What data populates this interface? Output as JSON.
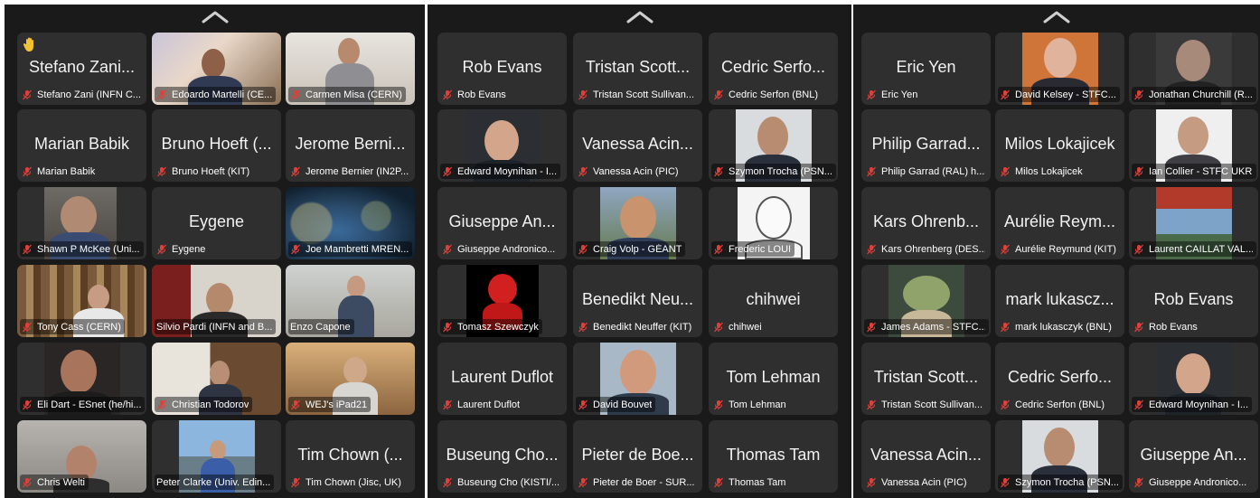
{
  "panels": [
    {
      "tiles": [
        {
          "big": "Stefano Zani...",
          "label": "Stefano Zani (INFN C...",
          "muted": true,
          "hand_raised": true
        },
        {
          "big": "",
          "label": "Edoardo Martelli (CE...",
          "muted": true,
          "video": "room-poster"
        },
        {
          "big": "",
          "label": "Carmen Misa (CERN)",
          "muted": true,
          "video": "person-light"
        },
        {
          "big": "Marian Babik",
          "label": "Marian Babik",
          "muted": true
        },
        {
          "big": "Bruno Hoeft (...",
          "label": "Bruno Hoeft (KIT)",
          "muted": true
        },
        {
          "big": "Jerome Berni...",
          "label": "Jerome Bernier (IN2P...",
          "muted": true
        },
        {
          "big": "",
          "label": "Shawn P McKee (Uni...",
          "muted": true,
          "video": "portrait-gray"
        },
        {
          "big": "Eygene",
          "label": "Eygene",
          "muted": true
        },
        {
          "big": "",
          "label": "Joe Mambretti MREN...",
          "muted": true,
          "video": "earth"
        },
        {
          "big": "",
          "label": "Tony Cass (CERN)",
          "muted": true,
          "video": "bookshelf"
        },
        {
          "big": "",
          "label": "Silvio Pardi (INFN and B...",
          "muted": false,
          "active": true,
          "video": "office-red"
        },
        {
          "big": "",
          "label": "Enzo Capone",
          "muted": false,
          "video": "room-light"
        },
        {
          "big": "",
          "label": "Eli Dart - ESnet (he/hi...",
          "muted": true,
          "video": "portrait-dark"
        },
        {
          "big": "",
          "label": "Christian Todorov",
          "muted": true,
          "video": "room-window"
        },
        {
          "big": "",
          "label": "WEJ's iPad21",
          "muted": true,
          "video": "room-warm"
        },
        {
          "big": "",
          "label": "Chris Welti",
          "muted": true,
          "video": "portrait-wide"
        },
        {
          "big": "",
          "label": "Peter Clarke (Univ. Edin...",
          "muted": false,
          "video": "outdoor"
        },
        {
          "big": "Tim Chown (...",
          "label": "Tim Chown (Jisc, UK)",
          "muted": true
        }
      ]
    },
    {
      "tiles": [
        {
          "big": "Rob Evans",
          "label": "Rob Evans",
          "muted": true
        },
        {
          "big": "Tristan Scott...",
          "label": "Tristan Scott Sullivan...",
          "muted": true
        },
        {
          "big": "Cedric Serfo...",
          "label": "Cedric Serfon (BNL)",
          "muted": true
        },
        {
          "big": "",
          "label": "Edward Moynihan - I...",
          "muted": true,
          "video": "photo-bald"
        },
        {
          "big": "Vanessa Acin...",
          "label": "Vanessa Acin (PIC)",
          "muted": true
        },
        {
          "big": "",
          "label": "Szymon Trocha (PSN...",
          "muted": true,
          "video": "photo-beard"
        },
        {
          "big": "Giuseppe An...",
          "label": "Giuseppe Andronico...",
          "muted": true
        },
        {
          "big": "",
          "label": "Craig Volp - GÉANT",
          "muted": true,
          "video": "photo-smile"
        },
        {
          "big": "",
          "label": "Frederic LOUI",
          "muted": true,
          "video": "sketch"
        },
        {
          "big": "",
          "label": "Tomasz Szewczyk",
          "muted": true,
          "video": "devil"
        },
        {
          "big": "Benedikt Neu...",
          "label": "Benedikt Neuffer (KIT)",
          "muted": true
        },
        {
          "big": "chihwei",
          "label": "chihwei",
          "muted": true
        },
        {
          "big": "Laurent Duflot",
          "label": "Laurent Duflot",
          "muted": true
        },
        {
          "big": "",
          "label": "David Bouvet",
          "muted": true,
          "video": "photo-young"
        },
        {
          "big": "Tom Lehman",
          "label": "Tom Lehman",
          "muted": true
        },
        {
          "big": "Buseung Cho...",
          "label": "Buseung Cho (KISTI/...",
          "muted": true
        },
        {
          "big": "Pieter de Boe...",
          "label": "Pieter de Boer - SUR...",
          "muted": true
        },
        {
          "big": "Thomas Tam",
          "label": "Thomas Tam",
          "muted": true
        }
      ]
    },
    {
      "tiles": [
        {
          "big": "Eric Yen",
          "label": "Eric Yen",
          "muted": true
        },
        {
          "big": "",
          "label": "David Kelsey - STFC...",
          "muted": true,
          "video": "photo-orange"
        },
        {
          "big": "",
          "label": "Jonathan Churchill (R...",
          "muted": true,
          "video": "photo-gray"
        },
        {
          "big": "Philip Garrad...",
          "label": "Philip Garrad (RAL) h...",
          "muted": true
        },
        {
          "big": "Milos Lokajicek",
          "label": "Milos Lokajicek",
          "muted": true
        },
        {
          "big": "",
          "label": "Ian Collier - STFC UKRI",
          "muted": true,
          "video": "photo-white"
        },
        {
          "big": "Kars Ohrenb...",
          "label": "Kars Ohrenberg (DES...",
          "muted": true
        },
        {
          "big": "Aurélie Reym...",
          "label": "Aurélie Reymund (KIT)",
          "muted": true
        },
        {
          "big": "",
          "label": "Laurent CAILLAT VAL...",
          "muted": true,
          "video": "landscape"
        },
        {
          "big": "",
          "label": "James Adams - STFC...",
          "muted": true,
          "video": "yoda"
        },
        {
          "big": "mark lukascz...",
          "label": "mark lukasczyk (BNL)",
          "muted": true
        },
        {
          "big": "Rob Evans",
          "label": "Rob Evans",
          "muted": true
        },
        {
          "big": "Tristan Scott...",
          "label": "Tristan Scott Sullivan...",
          "muted": true
        },
        {
          "big": "Cedric Serfo...",
          "label": "Cedric Serfon (BNL)",
          "muted": true
        },
        {
          "big": "",
          "label": "Edward Moynihan - I...",
          "muted": true,
          "video": "photo-bald"
        },
        {
          "big": "Vanessa Acin...",
          "label": "Vanessa Acin (PIC)",
          "muted": true
        },
        {
          "big": "",
          "label": "Szymon Trocha (PSN...",
          "muted": true,
          "video": "photo-beard"
        },
        {
          "big": "Giuseppe An...",
          "label": "Giuseppe Andronico...",
          "muted": true
        }
      ]
    }
  ],
  "icons": {
    "scroll_up": "chevron-up-icon",
    "muted_mic": "mic-muted-icon",
    "raised_hand": "raised-hand-icon"
  },
  "colors": {
    "panel_bg": "#1a1a1a",
    "tile_bg": "#2f2f2f",
    "muted_icon": "#e0403a",
    "active_speaker": "#4fbf4f"
  }
}
